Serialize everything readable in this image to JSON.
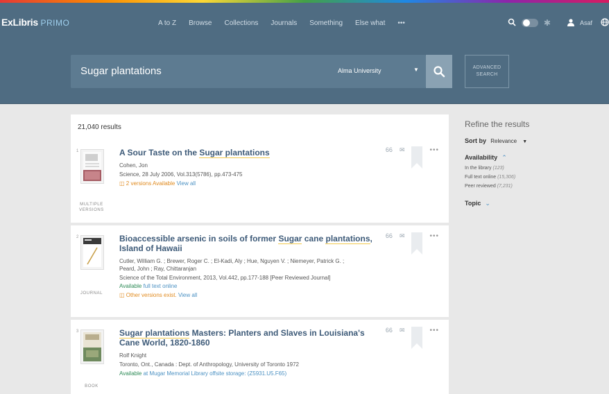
{
  "header": {
    "logo_main": "ExLibris",
    "logo_sub": "PRIMO",
    "nav": [
      "A to Z",
      "Browse",
      "Collections",
      "Journals",
      "Something",
      "Else what",
      "•••"
    ],
    "user_name": "Asaf"
  },
  "search": {
    "query": "Sugar plantations",
    "scope": "Alma University",
    "advanced_line1": "ADVANCED",
    "advanced_line2": "SEARCH"
  },
  "results": {
    "count_label": "21,040 results",
    "items": [
      {
        "index": "1",
        "title_pre": "A Sour Taste on the ",
        "title_hl": "Sugar plantations",
        "title_post": "",
        "author": "Cohen, Jon",
        "source": "Science, 28 July 2006, Vol.313(5786), pp.473-475",
        "versions_text": "2 versions Available",
        "versions_link": "View all",
        "type_line1": "MULTIPLE",
        "type_line2": "VERSIONS"
      },
      {
        "index": "2",
        "title_pre": "Bioaccessible arsenic in soils of former ",
        "title_hl1": "Sugar",
        "title_mid": " cane ",
        "title_hl2": "plantations",
        "title_post": ", Island of Hawaii",
        "author_line1": "Cutler, William G. ; Brewer, Roger C. ; El-Kadi, Aly ; Hue, Nguyen V. ; Niemeyer, Patrick G. ;",
        "author_line2": "Peard, John ; Ray, Chittaranjan",
        "source": "Science of the Total Environment, 2013, Vol.442, pp.177-188 [Peer Reviewed Journal]",
        "avail_label": "Available",
        "avail_link": "full text online",
        "versions_text": "Other versions exist.",
        "versions_link": "View all",
        "type_line1": "JOURNAL"
      },
      {
        "index": "3",
        "title_hl": "Sugar plantations",
        "title_post": " Masters: Planters and Slaves in Louisiana's Cane World, 1820-1860",
        "author": "Rolf Knight",
        "source": "Toronto, Ont., Canada : Dept. of Anthropology, University of Toronto 1972",
        "avail_label": "Available",
        "avail_link": "at Mugar Memorial Library offsite storage: (Z5931.U5.F65)",
        "type_line1": "BOOK"
      }
    ],
    "action_cite": "66",
    "action_more": "•••"
  },
  "refine": {
    "title": "Refine the results",
    "sort_label": "Sort by",
    "sort_value": "Relevance",
    "availability_label": "Availability",
    "facets": [
      {
        "label": "In the library",
        "count": "(123)"
      },
      {
        "label": "Full text online",
        "count": "(15,306)"
      },
      {
        "label": "Peer reviewed",
        "count": "(7,231)"
      }
    ],
    "topic_label": "Topic"
  },
  "colors": {
    "header_bg": "#4f6c82",
    "title_link": "#3d5a78",
    "available_green": "#2e8b57",
    "versions_orange": "#e08a1e"
  }
}
